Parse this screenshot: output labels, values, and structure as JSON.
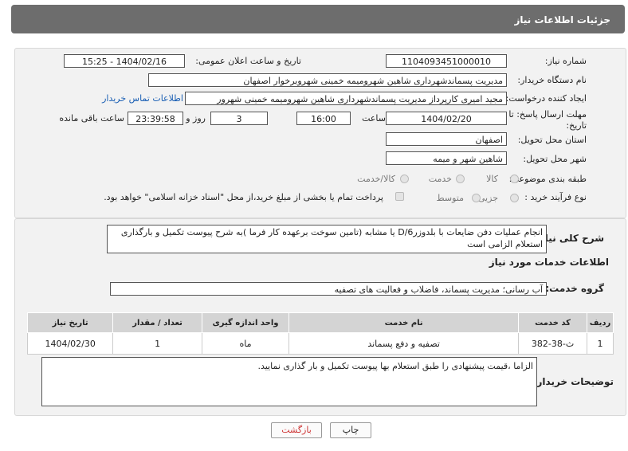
{
  "header": {
    "title": "جزئیات اطلاعات نیاز"
  },
  "form": {
    "need_number_label": "شماره نیاز:",
    "need_number": "1104093451000010",
    "announce_label": "تاریخ و ساعت اعلان عمومی:",
    "announce_value": "1404/02/16 - 15:25",
    "buyer_org_label": "نام دستگاه خریدار:",
    "buyer_org": "مدیریت پسماندشهرداری شاهین شهرومیمه خمینی شهروبرخوار اصفهان",
    "creator_label": "ایجاد کننده درخواست:",
    "creator": "مجید امیری کارپرداز مدیریت پسماندشهرداری شاهین شهرومیمه خمینی شهرور",
    "contact_link": "اطلاعات تماس خریدار",
    "deadline_label_1": "مهلت ارسال پاسخ: تا",
    "deadline_label_2": "تاریخ:",
    "deadline_date": "1404/02/20",
    "time_label": "ساعت",
    "deadline_time": "16:00",
    "days_value": "3",
    "days_label": "روز و",
    "remaining_time": "23:39:58",
    "remaining_label": "ساعت باقی مانده",
    "province_label": "استان محل تحویل:",
    "province": "اصفهان",
    "city_label": "شهر محل تحویل:",
    "city": "شاهین شهر و میمه",
    "category_label": "طبقه بندی موضوعی:",
    "category_options": [
      "کالا",
      "خدمت",
      "کالا/خدمت"
    ],
    "process_label": "نوع فرآیند خرید :",
    "process_options": [
      "جزیی",
      "متوسط"
    ],
    "treasury_note": "پرداخت تمام یا بخشی از مبلغ خرید،از محل \"اسناد خزانه اسلامی\" خواهد بود."
  },
  "details": {
    "general_desc_label": "شرح کلی نیاز:",
    "general_desc": "انجام عملیات دفن ضایعات با بلدوزرD/6 یا مشابه (تامین سوخت برعهده کار فرما )به شرح پیوست تکمیل و بارگذاری استعلام الزامی است",
    "services_title": "اطلاعات خدمات مورد نیاز",
    "service_group_label": "گروه خدمت:",
    "service_group": "آب رسانی؛ مدیریت پسماند، فاضلاب و فعالیت های تصفیه",
    "table": {
      "headers": [
        "ردیف",
        "کد خدمت",
        "نام خدمت",
        "واحد اندازه گیری",
        "تعداد / مقدار",
        "تاریخ نیاز"
      ],
      "rows": [
        [
          "1",
          "ث-38-382",
          "تصفیه و دفع پسماند",
          "ماه",
          "1",
          "1404/02/30"
        ]
      ]
    },
    "buyer_notes_label": "توضیحات خریدار:",
    "buyer_notes": "الزاما ،قیمت پیشنهادی را طبق استعلام بها پیوست  تکمیل و بار گذاری نمایید."
  },
  "buttons": {
    "print": "چاپ",
    "back": "بازگشت"
  }
}
